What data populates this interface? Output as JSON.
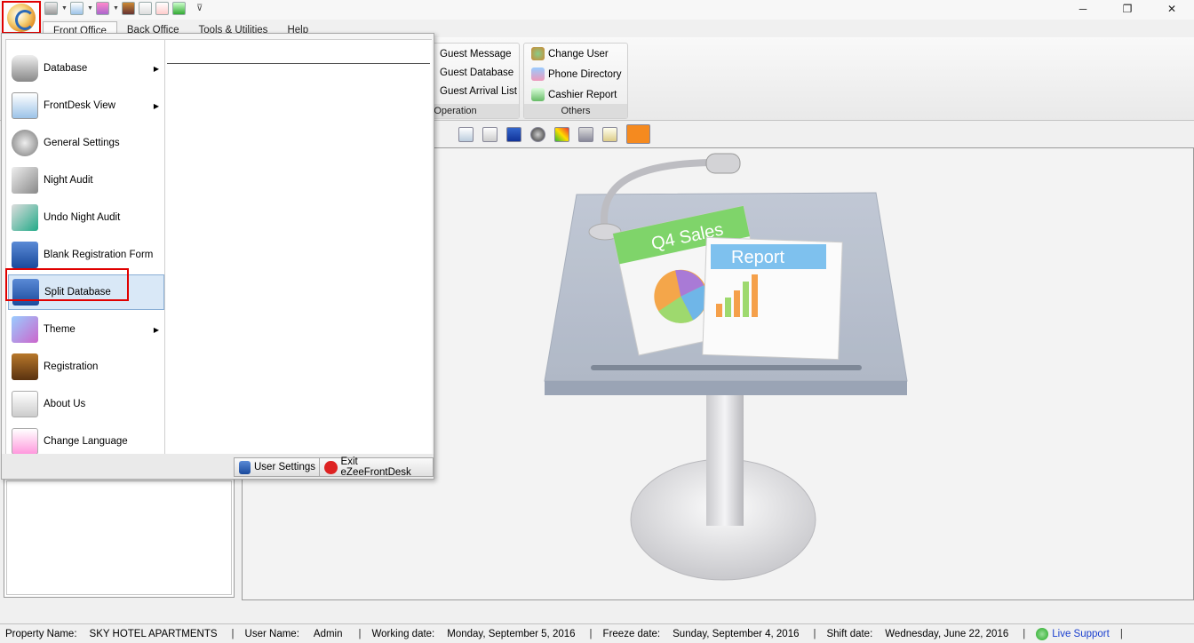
{
  "window": {
    "minimize": "─",
    "restore": "❐",
    "close": "✕"
  },
  "qat": {
    "customize": "⊽"
  },
  "tabs": [
    {
      "label": "Front Office"
    },
    {
      "label": "Back Office"
    },
    {
      "label": "Tools & Utilities"
    },
    {
      "label": "Help"
    }
  ],
  "ribbon": {
    "operation": {
      "label": "Operation",
      "items": [
        "Guest Message",
        "Guest Database",
        "Guest Arrival List"
      ]
    },
    "others": {
      "label": "Others",
      "items": [
        "Change User",
        "Phone Directory",
        "Cashier Report"
      ]
    }
  },
  "illustration": {
    "sign": "Q4 Sales",
    "report": "Report"
  },
  "menu": {
    "items": [
      {
        "label": "Database",
        "icon": "database-icon",
        "submenu": true
      },
      {
        "label": "FrontDesk View",
        "icon": "frontdesk-view-icon",
        "submenu": true
      },
      {
        "label": "General Settings",
        "icon": "gear-icon",
        "submenu": false
      },
      {
        "label": "Night Audit",
        "icon": "lamp-icon",
        "submenu": false
      },
      {
        "label": "Undo Night Audit",
        "icon": "undo-lamp-icon",
        "submenu": false
      },
      {
        "label": "Blank Registration Form",
        "icon": "form-icon",
        "submenu": false
      },
      {
        "label": "Split Database",
        "icon": "split-database-icon",
        "submenu": false,
        "selected": true
      },
      {
        "label": "Theme",
        "icon": "theme-icon",
        "submenu": true
      },
      {
        "label": "Registration",
        "icon": "registration-icon",
        "submenu": false
      },
      {
        "label": "About Us",
        "icon": "about-icon",
        "submenu": false
      },
      {
        "label": "Change Language",
        "icon": "language-icon",
        "submenu": false
      }
    ],
    "submenu_arrow": "▶",
    "footer": {
      "user_settings": "User Settings",
      "exit": "Exit eZeeFrontDesk"
    }
  },
  "status": {
    "property_label": "Property Name:",
    "property_value": "SKY HOTEL APARTMENTS",
    "user_label": "User Name:",
    "user_value": "Admin",
    "working_label": "Working date:",
    "working_value": "Monday, September 5, 2016",
    "freeze_label": "Freeze date:",
    "freeze_value": "Sunday, September 4, 2016",
    "shift_label": "Shift date:",
    "shift_value": "Wednesday, June 22, 2016",
    "live_support": "Live Support",
    "separator": "|"
  },
  "colors": {
    "highlight_red": "#e00000",
    "link_blue": "#1a3fcf",
    "selection": "#d9e8f7"
  }
}
